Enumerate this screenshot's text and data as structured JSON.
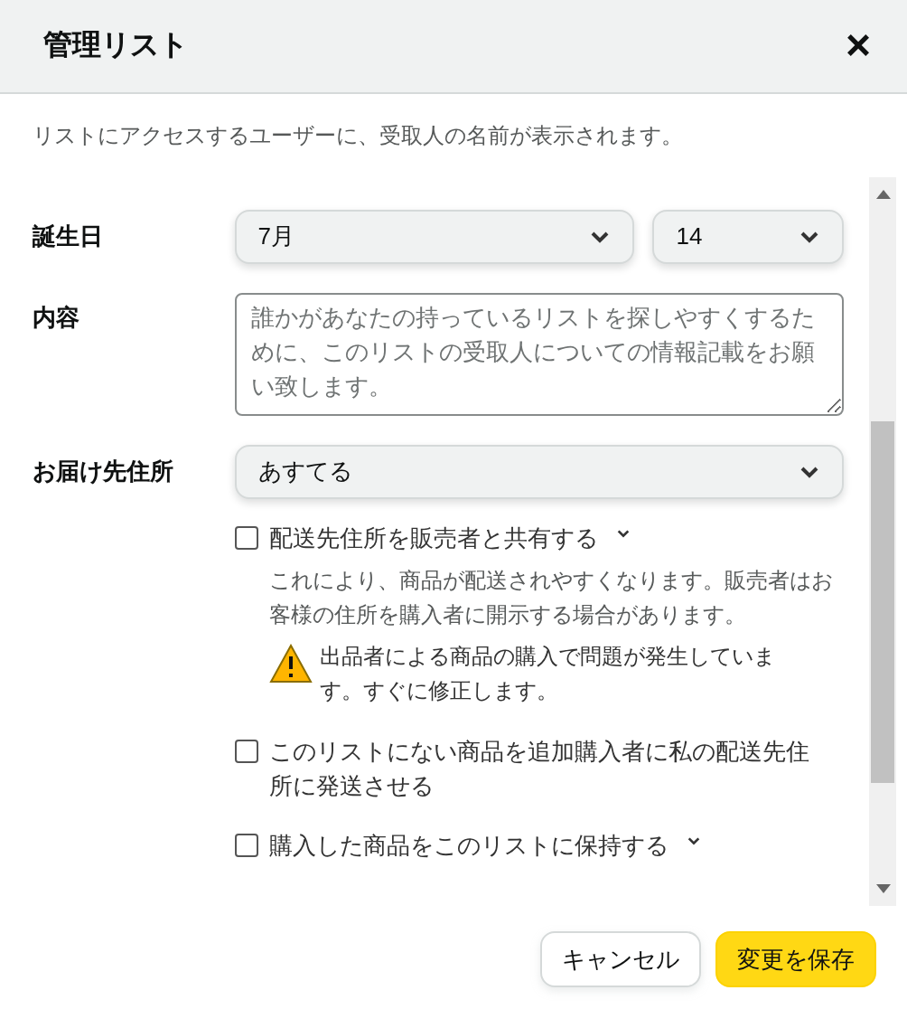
{
  "dialog": {
    "title": "管理リスト",
    "close": "×"
  },
  "description": "リストにアクセスするユーザーに、受取人の名前が表示されます。",
  "birthday": {
    "label": "誕生日",
    "month": "7月",
    "day": "14"
  },
  "content": {
    "label": "内容",
    "placeholder": "誰かがあなたの持っているリストを探しやすくするために、このリストの受取人についての情報記載をお願い致します。"
  },
  "address": {
    "label": "お届け先住所",
    "value": "あすてる"
  },
  "options": [
    {
      "label": "配送先住所を販売者と共有する",
      "checked": false,
      "expandable": true,
      "details": "これにより、商品が配送されやすくなります。販売者はお客様の住所を購入者に開示する場合があります。",
      "warning": "出品者による商品の購入で問題が発生しています。すぐに修正します。"
    },
    {
      "label": "このリストにない商品を追加購入者に私の配送先住所に発送させる",
      "checked": false,
      "expandable": false
    },
    {
      "label": "購入した商品をこのリストに保持する",
      "checked": false,
      "expandable": true
    }
  ],
  "buttons": [
    {
      "label": "キャンセル",
      "kind": "secondary"
    },
    {
      "label": "変更を保存",
      "kind": "primary"
    }
  ]
}
